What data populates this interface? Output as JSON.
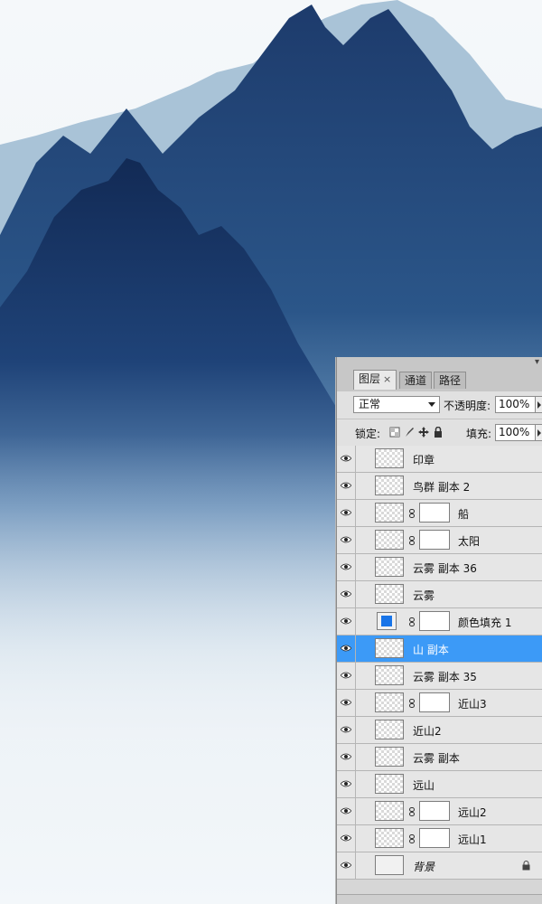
{
  "panel": {
    "tabs": [
      {
        "label": "图层",
        "close": "×"
      },
      {
        "label": "通道"
      },
      {
        "label": "路径"
      }
    ],
    "blend_mode": "正常",
    "opacity_label": "不透明度:",
    "opacity_value": "100%",
    "lock_label": "锁定:",
    "fill_label": "填充:",
    "fill_value": "100%"
  },
  "layers": [
    {
      "name": "印章",
      "has_mask": false,
      "selected": false
    },
    {
      "name": "鸟群 副本 2",
      "has_mask": false,
      "selected": false
    },
    {
      "name": "船",
      "has_mask": true,
      "selected": false
    },
    {
      "name": "太阳",
      "has_mask": true,
      "selected": false
    },
    {
      "name": "云雾 副本 36",
      "has_mask": false,
      "selected": false
    },
    {
      "name": "云雾",
      "has_mask": false,
      "selected": false
    },
    {
      "name": "颜色填充 1",
      "has_mask": true,
      "selected": false,
      "fill_color": "#1874e8"
    },
    {
      "name": "山 副本",
      "has_mask": false,
      "selected": true
    },
    {
      "name": "云雾 副本 35",
      "has_mask": false,
      "selected": false
    },
    {
      "name": "近山3",
      "has_mask": true,
      "selected": false
    },
    {
      "name": "近山2",
      "has_mask": false,
      "selected": false
    },
    {
      "name": "云雾 副本",
      "has_mask": false,
      "selected": false
    },
    {
      "name": "远山",
      "has_mask": false,
      "selected": false
    },
    {
      "name": "远山2",
      "has_mask": true,
      "selected": false
    },
    {
      "name": "远山1",
      "has_mask": true,
      "selected": false
    },
    {
      "name": "背景",
      "has_mask": false,
      "selected": false,
      "locked": true
    }
  ],
  "colors": {
    "selection": "#3c9af7",
    "mountain_dark": "#15305e",
    "mountain_mid": "#2e5a8e",
    "far_mountain": "#9ab9d1",
    "mist": "#eef3f6"
  }
}
